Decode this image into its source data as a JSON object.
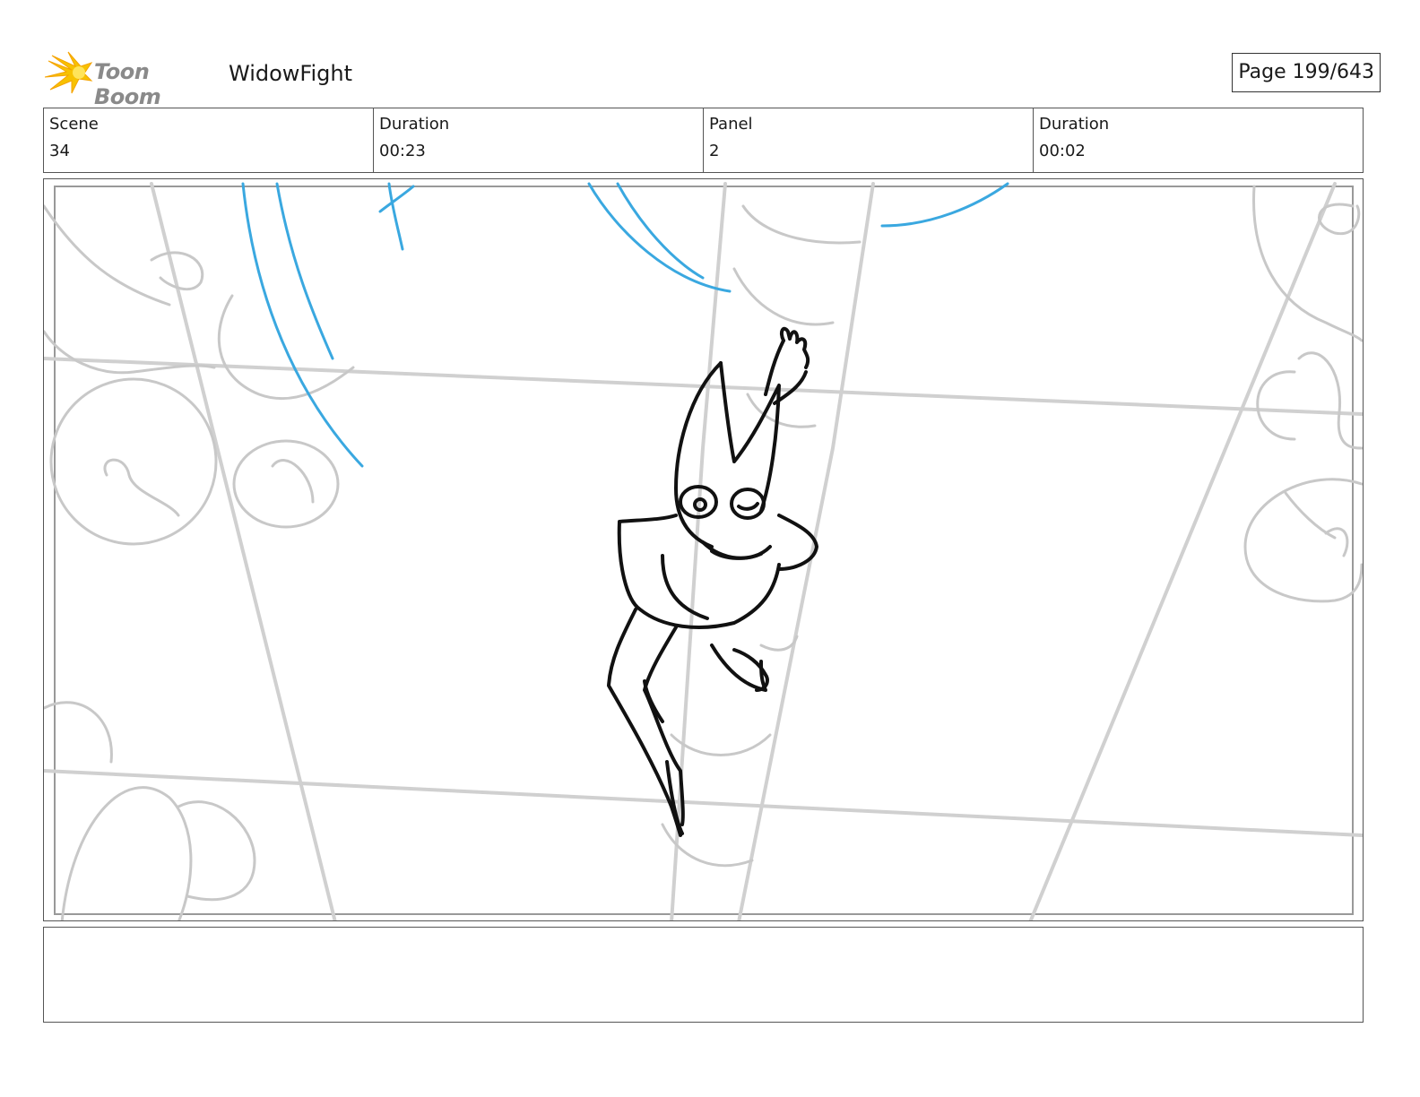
{
  "header": {
    "logo_text": "Toon Boom",
    "project_title": "WidowFight",
    "page_label": "Page 199/643"
  },
  "info": {
    "scene_label": "Scene",
    "scene_value": "34",
    "scene_duration_label": "Duration",
    "scene_duration_value": "00:23",
    "panel_label": "Panel",
    "panel_value": "2",
    "panel_duration_label": "Duration",
    "panel_duration_value": "00:02"
  },
  "colors": {
    "sketch_gray": "#c8c8c8",
    "sketch_blue": "#3aa8e0",
    "ink": "#111111",
    "logo_orange": "#f5a300"
  },
  "notes": {
    "text": ""
  }
}
